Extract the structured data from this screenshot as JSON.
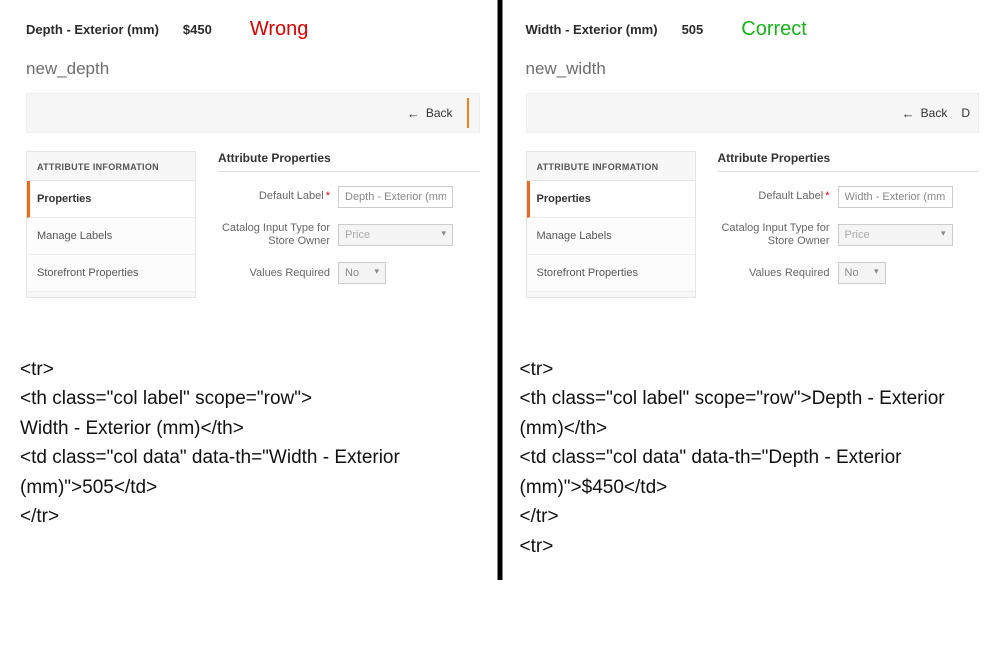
{
  "left": {
    "attr_label": "Depth - Exterior (mm)",
    "attr_value": "$450",
    "verdict": "Wrong",
    "code_title": "new_depth",
    "back_label": "Back",
    "sidebar_header": "ATTRIBUTE INFORMATION",
    "sidebar_items": [
      "Properties",
      "Manage Labels",
      "Storefront Properties"
    ],
    "props_title": "Attribute Properties",
    "form": {
      "default_label_label": "Default Label",
      "default_label_value": "Depth - Exterior (mm)",
      "catalog_input_label": "Catalog Input Type for Store Owner",
      "catalog_input_value": "Price",
      "values_required_label": "Values Required",
      "values_required_value": "No"
    },
    "code": "<tr>\n<th class=\"col label\" scope=\"row\">\nWidth - Exterior (mm)</th>\n<td class=\"col data\" data-th=\"Width - Exterior (mm)\">505</td>\n</tr>"
  },
  "right": {
    "attr_label": "Width - Exterior (mm)",
    "attr_value": "505",
    "verdict": "Correct",
    "code_title": "new_width",
    "back_label": "Back",
    "edge_letter": "D",
    "sidebar_header": "ATTRIBUTE INFORMATION",
    "sidebar_items": [
      "Properties",
      "Manage Labels",
      "Storefront Properties"
    ],
    "props_title": "Attribute Properties",
    "form": {
      "default_label_label": "Default Label",
      "default_label_value": "Width - Exterior (mm)",
      "catalog_input_label": "Catalog Input Type for Store Owner",
      "catalog_input_value": "Price",
      "values_required_label": "Values Required",
      "values_required_value": "No"
    },
    "code": "<tr>\n<th class=\"col label\" scope=\"row\">Depth - Exterior (mm)</th>\n<td class=\"col data\" data-th=\"Depth - Exterior (mm)\">$450</td>\n</tr>\n<tr>"
  }
}
